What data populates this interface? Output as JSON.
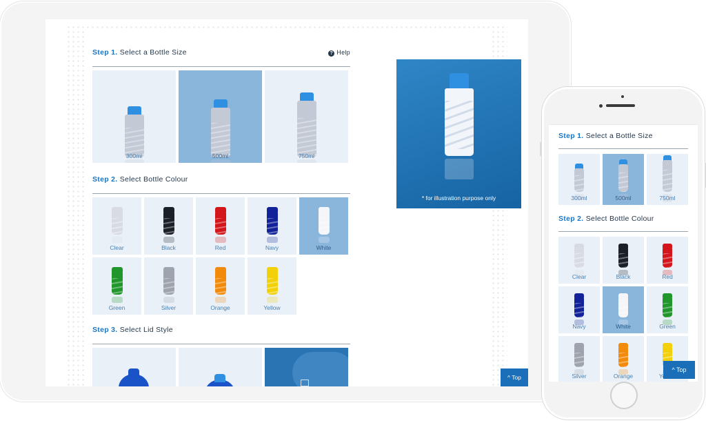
{
  "tablet": {
    "step1": {
      "number": "Step 1.",
      "title": "Select a Bottle Size",
      "help": "Help"
    },
    "sizes": [
      {
        "label": "300ml",
        "selected": false
      },
      {
        "label": "500ml",
        "selected": true
      },
      {
        "label": "750ml",
        "selected": false
      }
    ],
    "step2": {
      "number": "Step 2.",
      "title": "Select Bottle Colour"
    },
    "colours": [
      {
        "label": "Clear",
        "color": "#d8dbe3",
        "selected": false
      },
      {
        "label": "Black",
        "color": "#1b1f27",
        "selected": false
      },
      {
        "label": "Red",
        "color": "#d3161b",
        "selected": false
      },
      {
        "label": "Navy",
        "color": "#12239a",
        "selected": false
      },
      {
        "label": "White",
        "color": "#f4f6fa",
        "selected": true
      },
      {
        "label": "Green",
        "color": "#21962b",
        "selected": false
      },
      {
        "label": "Silver",
        "color": "#9ea3ad",
        "selected": false
      },
      {
        "label": "Orange",
        "color": "#f28a0c",
        "selected": false
      },
      {
        "label": "Yellow",
        "color": "#f2d10b",
        "selected": false
      }
    ],
    "step3": {
      "number": "Step 3.",
      "title": "Select Lid Style"
    },
    "preview_note": "* for illustration purpose only",
    "top_button": "^ Top"
  },
  "phone": {
    "step1": {
      "number": "Step 1.",
      "title": "Select a Bottle Size"
    },
    "sizes": [
      {
        "label": "300ml",
        "selected": false
      },
      {
        "label": "500ml",
        "selected": true
      },
      {
        "label": "750ml",
        "selected": false
      }
    ],
    "step2": {
      "number": "Step 2.",
      "title": "Select Bottle Colour"
    },
    "colours": [
      {
        "label": "Clear",
        "color": "#d8dbe3",
        "selected": false
      },
      {
        "label": "Black",
        "color": "#1b1f27",
        "selected": false
      },
      {
        "label": "Red",
        "color": "#d3161b",
        "selected": false
      },
      {
        "label": "Navy",
        "color": "#12239a",
        "selected": false
      },
      {
        "label": "White",
        "color": "#f4f6fa",
        "selected": true
      },
      {
        "label": "Green",
        "color": "#21962b",
        "selected": false
      },
      {
        "label": "Silver",
        "color": "#9ea3ad",
        "selected": false
      },
      {
        "label": "Orange",
        "color": "#f28a0c",
        "selected": false
      },
      {
        "label": "Yellow",
        "color": "#f2d10b",
        "selected": false
      }
    ],
    "top_button": "^ Top"
  },
  "colors": {
    "accent": "#1a76c1",
    "selected_tile": "#8bb6dc",
    "tile": "#e9f0f7",
    "cap_blue": "#2f8fe0",
    "lid_blue": "#1a53c8"
  }
}
